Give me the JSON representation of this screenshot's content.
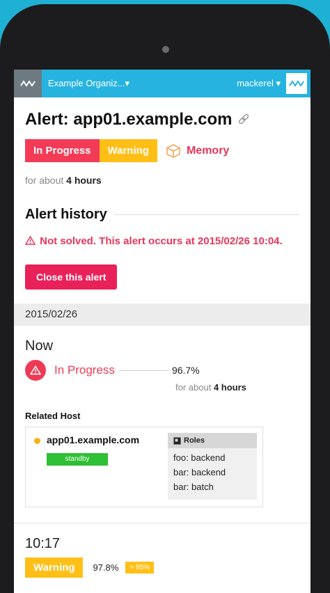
{
  "topbar": {
    "organization": "Example Organiz...",
    "user": "mackerel",
    "dropdown_arrow": "▾",
    "logo_icon": "mackerel-wave-icon",
    "avatar_icon": "mackerel-wave-icon"
  },
  "alert": {
    "title": "Alert: app01.example.com",
    "status": "In Progress",
    "level": "Warning",
    "metric": "Memory",
    "duration_prefix": "for about",
    "duration": "4 hours"
  },
  "history": {
    "title": "Alert history",
    "message": "Not solved. This alert occurs at 2015/02/26 10:04.",
    "close_button": "Close this alert"
  },
  "timeline": {
    "date": "2015/02/26",
    "now": {
      "time": "Now",
      "status": "In Progress",
      "value": "96.7%",
      "duration_prefix": "for about",
      "duration": "4 hours"
    },
    "related": {
      "title": "Related Host",
      "host_name": "app01.example.com",
      "host_status": "standby",
      "roles_title": "Roles",
      "roles": [
        "foo: backend",
        "bar: backend",
        "bar: batch"
      ]
    },
    "second": {
      "time": "10:17",
      "level": "Warning",
      "value": "97.8%",
      "threshold": "> 95%"
    }
  },
  "colors": {
    "brand": "#27b3e0",
    "critical": "#f33a57",
    "warning": "#ffbf17",
    "ok": "#2fbf34"
  }
}
